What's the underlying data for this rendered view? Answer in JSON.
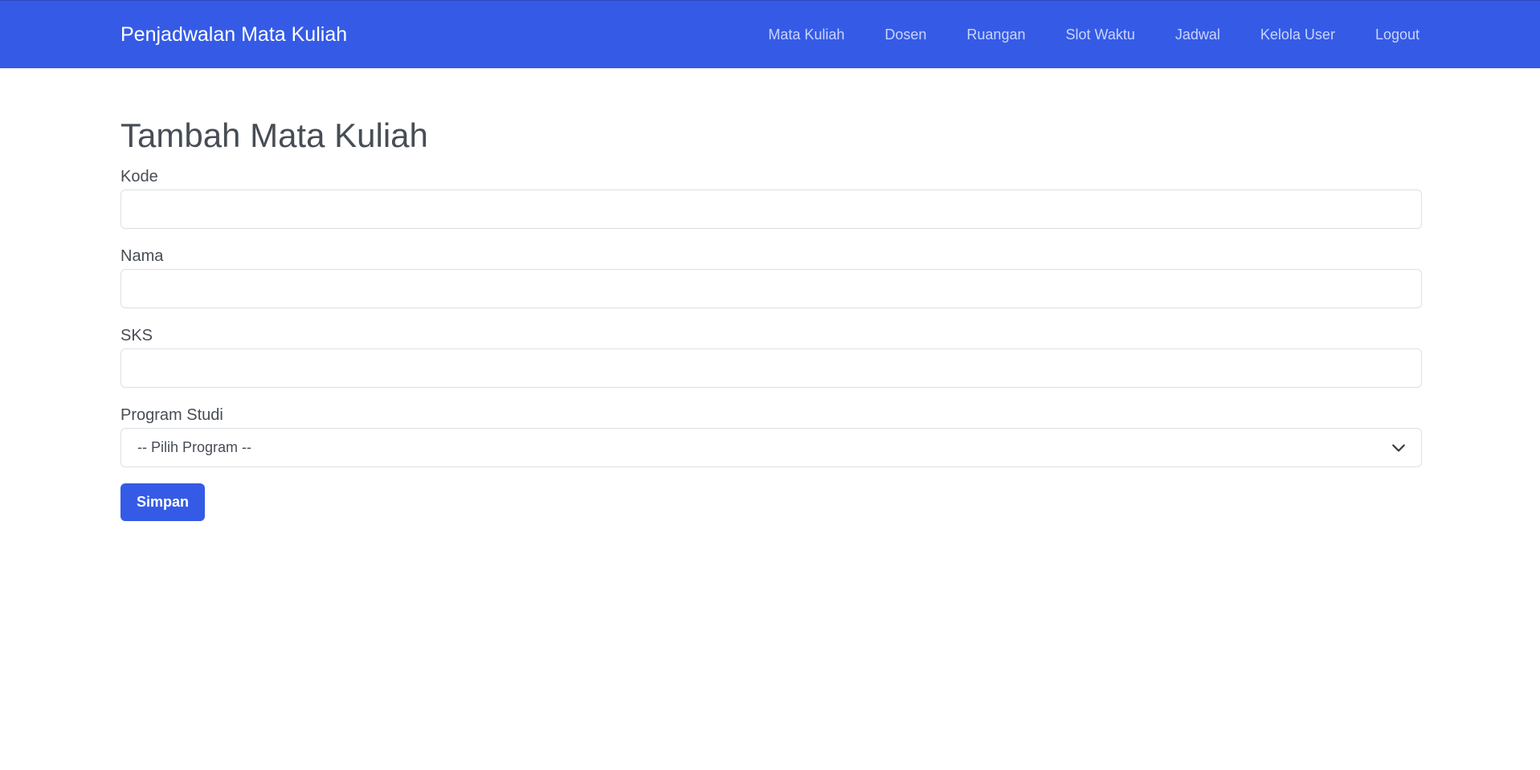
{
  "navbar": {
    "brand": "Penjadwalan Mata Kuliah",
    "links": [
      {
        "label": "Mata Kuliah"
      },
      {
        "label": "Dosen"
      },
      {
        "label": "Ruangan"
      },
      {
        "label": "Slot Waktu"
      },
      {
        "label": "Jadwal"
      },
      {
        "label": "Kelola User"
      },
      {
        "label": "Logout"
      }
    ],
    "bg_color": "#355be6"
  },
  "form": {
    "title": "Tambah Mata Kuliah",
    "fields": {
      "kode": {
        "label": "Kode",
        "value": ""
      },
      "nama": {
        "label": "Nama",
        "value": ""
      },
      "sks": {
        "label": "SKS",
        "value": ""
      },
      "program_studi": {
        "label": "Program Studi",
        "selected": "-- Pilih Program --"
      }
    },
    "submit_label": "Simpan"
  },
  "colors": {
    "accent": "#355be6",
    "text": "#474d55",
    "border": "#dcdfe4"
  }
}
